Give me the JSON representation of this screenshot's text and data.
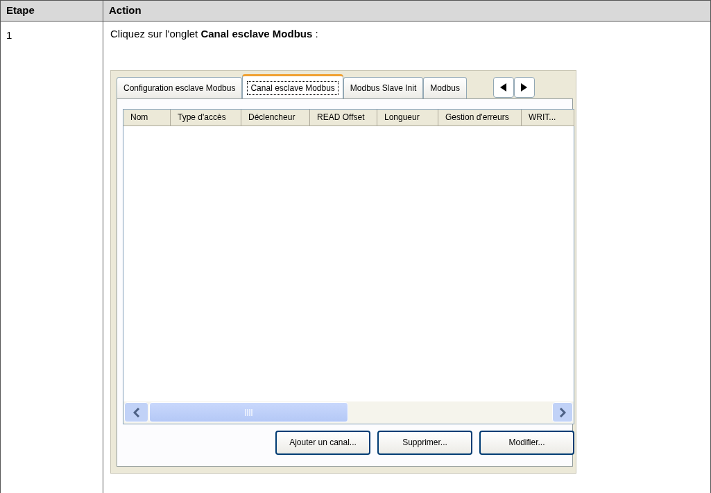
{
  "table": {
    "columns": [
      "Etape",
      "Action"
    ],
    "rows": [
      {
        "step": "1",
        "instruction": "Cliquez sur l'onglet **Canal esclave Modbus** :",
        "screenshot": {
          "tabs": [
            {
              "label": "Configuration esclave Modbus",
              "selected": false
            },
            {
              "label": "Canal esclave Modbus",
              "selected": true
            },
            {
              "label": "Modbus Slave Init",
              "selected": false
            },
            {
              "label": "Modbus",
              "selected": false
            }
          ],
          "grid_columns": [
            "Nom",
            "Type d'accès",
            "Déclencheur",
            "READ Offset",
            "Longueur",
            "Gestion d'erreurs",
            "WRIT..."
          ],
          "buttons": [
            "Ajouter un canal...",
            "Supprimer...",
            "Modifier..."
          ]
        }
      }
    ]
  }
}
